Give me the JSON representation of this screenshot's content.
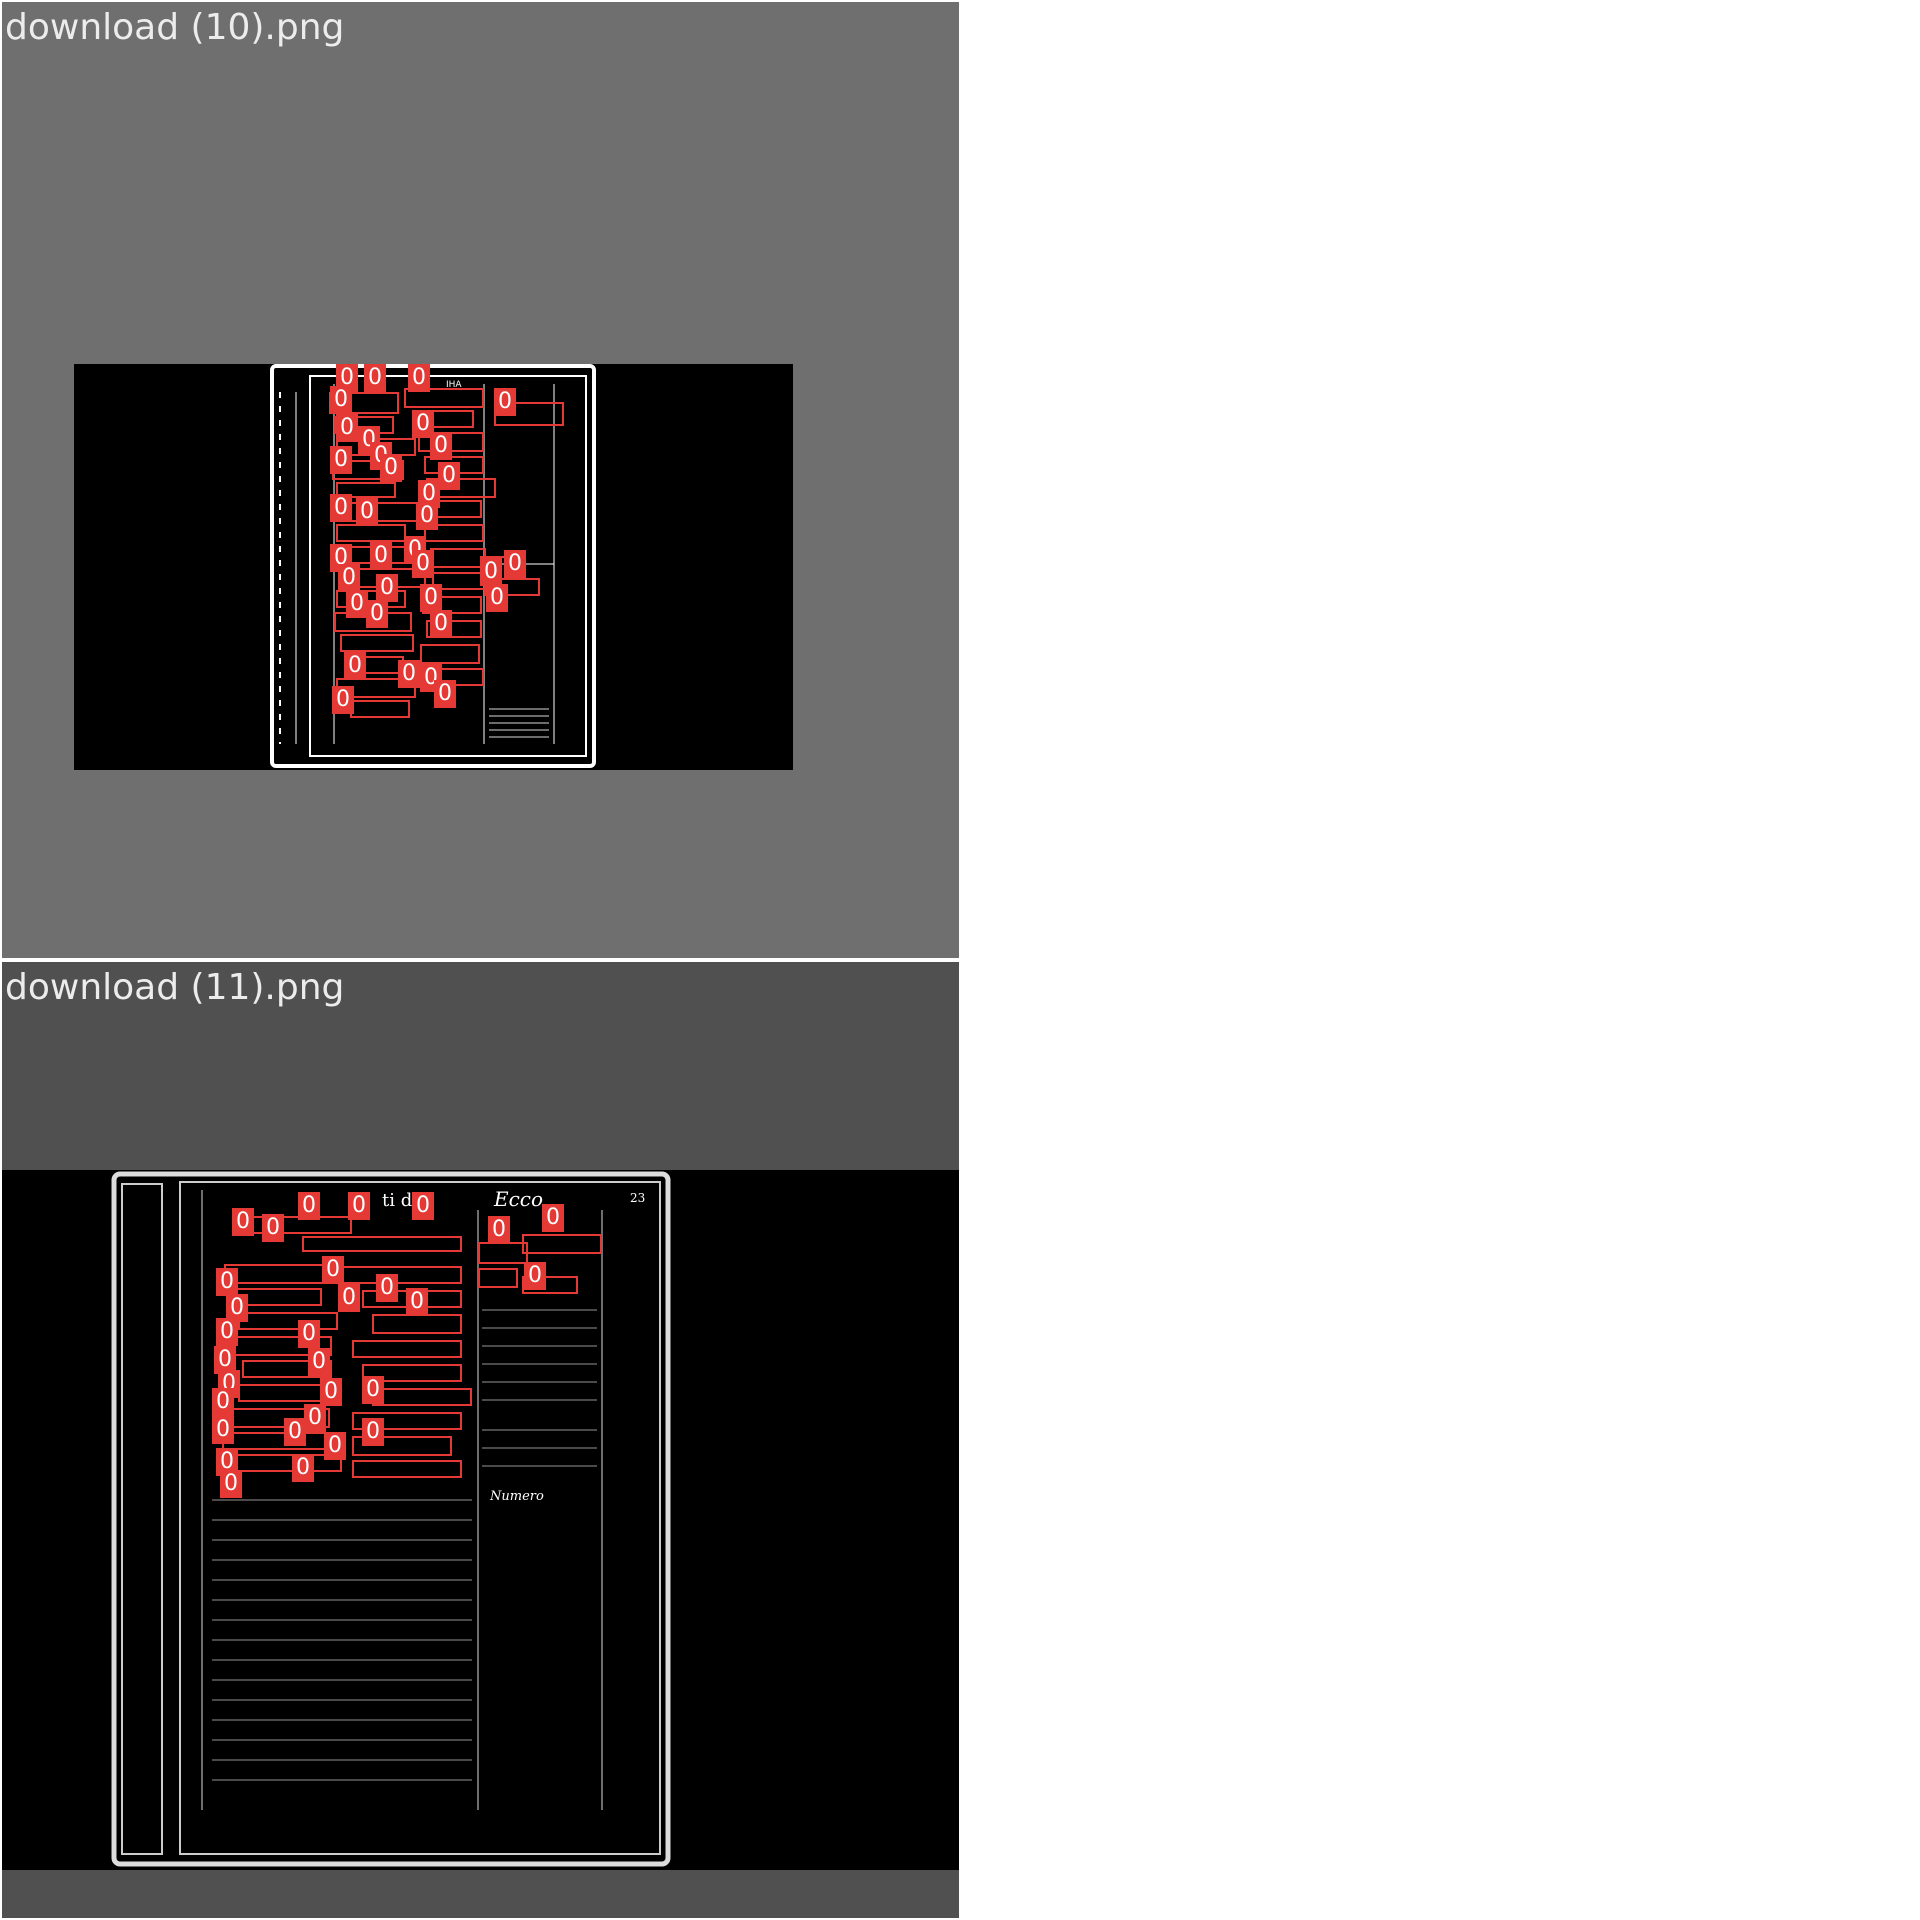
{
  "viewer": {
    "panels": [
      {
        "title": "download (10).png",
        "detection_label": "0"
      },
      {
        "title": "download (11).png",
        "detection_label": "0"
      }
    ]
  },
  "colors": {
    "panel1_bg": "#6f6f6f",
    "panel2_bg": "#505050",
    "image_bg": "#000000",
    "box_color": "#e53935",
    "label_text": "#ffffff"
  },
  "document_text": {
    "header_fragment": "IHA",
    "doc2_title_fragment": "ti di",
    "doc2_corner_script": "Ecco",
    "doc2_page_number": "23",
    "doc2_numero": "Numero"
  }
}
